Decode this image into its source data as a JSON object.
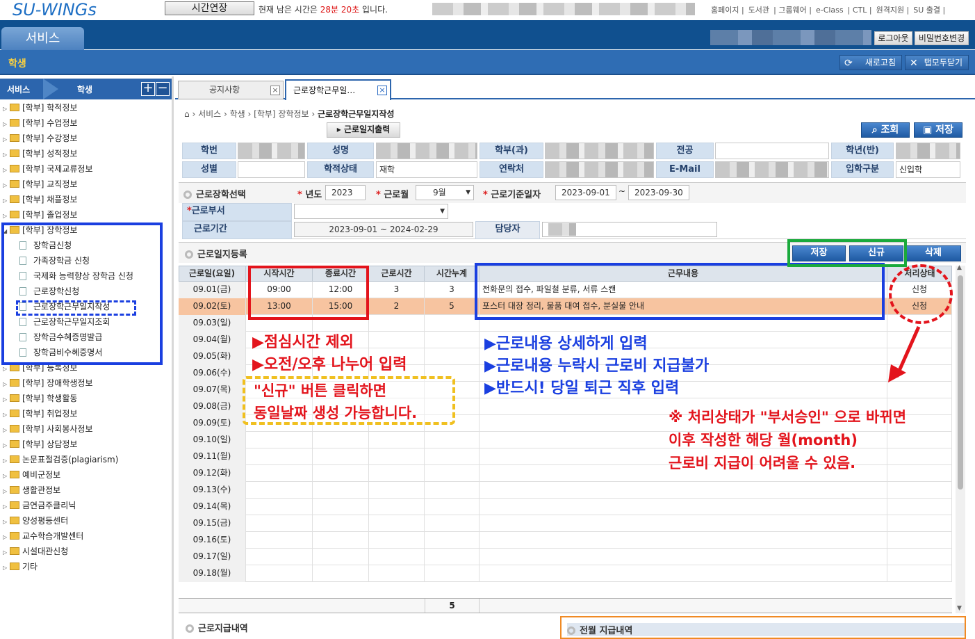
{
  "topbar": {
    "logo": "SU-WINGs",
    "time_extend_button": "시간연장",
    "time_prefix": "현재 남은 시간은 ",
    "time_remaining": "28분 20초",
    "time_suffix": " 입니다.",
    "links": [
      "홈페이지 |",
      "도서관",
      "| 그룹웨어 |",
      "e-Class",
      "| CTL |",
      "원격지원 |",
      "SU 출결 |"
    ]
  },
  "header": {
    "service_tab": "서비스",
    "logout": "로그아웃",
    "password_change": "비밀번호변경"
  },
  "studentbar": {
    "label": "학생",
    "refresh": "새로고침",
    "close_tabs": "탭모두닫기"
  },
  "left": {
    "header_service": "서비스",
    "header_student": "학생",
    "plus": "+",
    "minus": "−",
    "tree_top": [
      "[학부] 학적정보",
      "[학부] 수업정보",
      "[학부] 수강정보",
      "[학부] 성적정보",
      "[학부] 국제교류정보",
      "[학부] 교직정보",
      "[학부] 채플정보",
      "[학부] 졸업정보",
      "[학부] 장학정보"
    ],
    "tree_leaves": [
      "장학금신청",
      "가족장학금 신청",
      "국제화 능력향상 장학금 신청",
      "근로장학신청",
      "근로장학근무일지작성",
      "근로장학근무일지조회",
      "장학금수혜증명발급",
      "장학금비수혜증명서"
    ],
    "tree_bottom": [
      "[학부] 등록정보",
      "[학부] 장애학생정보",
      "[학부] 학생활동",
      "[학부] 취업정보",
      "[학부] 사회봉사정보",
      "[학부] 상담정보",
      "논문표절검증(plagiarism)",
      "예비군정보",
      "생활관정보",
      "금연금주클리닉",
      "양성평등센터",
      "교수학습개발센터",
      "시설대관신청",
      "기타"
    ]
  },
  "tabs": {
    "tab1": "공지사항",
    "tab2": "근로장학근무일…",
    "close": "×"
  },
  "breadcrumb": {
    "items": [
      "서비스",
      "학생",
      "[학부] 장학정보"
    ],
    "current": "근로장학근무일지작성"
  },
  "toolbar": {
    "print": "근로일지출력",
    "search": "조회",
    "save": "저장"
  },
  "student_info": {
    "student_id_label": "학번",
    "name_label": "성명",
    "dept_label": "학부(과)",
    "major_label": "전공",
    "grade_label": "학년(반)",
    "gender_label": "성별",
    "status_label": "학적상태",
    "status_value": "재학",
    "contact_label": "연락처",
    "email_label": "E-Mail",
    "admission_label": "입학구분",
    "admission_value": "신입학"
  },
  "selection": {
    "section_title": "근로장학선택",
    "year_label": "년도",
    "year_value": "2023",
    "month_label": "근로월",
    "month_value": "9월",
    "base_date_label": "근로기준일자",
    "date_from": "2023-09-01",
    "date_sep": "~",
    "date_to": "2023-09-30",
    "dept_label": "근로부서",
    "period_label": "근로기간",
    "period_value": "2023-09-01 ~ 2024-02-29",
    "manager_label": "담당자"
  },
  "log": {
    "section_title": "근로일지등록",
    "save": "저장",
    "new": "신규",
    "delete": "삭제",
    "columns": [
      "근로일(요일)",
      "시작시간",
      "종료시간",
      "근로시간",
      "시간누계",
      "근무내용",
      "처리상태"
    ],
    "rows": [
      {
        "date": "09.01(금)",
        "start": "09:00",
        "end": "12:00",
        "hours": "3",
        "cum": "3",
        "content": "전화문의 접수, 파일철 분류, 서류 스캔",
        "status": "신청"
      },
      {
        "date": "09.02(토)",
        "start": "13:00",
        "end": "15:00",
        "hours": "2",
        "cum": "5",
        "content": "포스터 대장 정리, 물품 대여 접수, 분실물 안내",
        "status": "신청"
      },
      {
        "date": "09.03(일)"
      },
      {
        "date": "09.04(월)"
      },
      {
        "date": "09.05(화)"
      },
      {
        "date": "09.06(수)"
      },
      {
        "date": "09.07(목)"
      },
      {
        "date": "09.08(금)"
      },
      {
        "date": "09.09(토)"
      },
      {
        "date": "09.10(일)"
      },
      {
        "date": "09.11(월)"
      },
      {
        "date": "09.12(화)"
      },
      {
        "date": "09.13(수)"
      },
      {
        "date": "09.14(목)"
      },
      {
        "date": "09.15(금)"
      },
      {
        "date": "09.16(토)"
      },
      {
        "date": "09.17(일)"
      },
      {
        "date": "09.18(월)"
      }
    ],
    "footer_total": "5"
  },
  "annotations": {
    "red1": "▶점심시간 제외",
    "red2": "▶오전/오후 나누어 입력",
    "yellow1": "\"신규\" 버튼 클릭하면",
    "yellow2": "동일날짜 생성 가능합니다.",
    "blue1": "▶근로내용 상세하게 입력",
    "blue2": "▶근로내용 누락시 근로비 지급불가",
    "blue3": "▶반드시! 당일 퇴근 직후 입력",
    "warn1": "※ 처리상태가 \"부서승인\" 으로 바뀌면",
    "warn2": "이후 작성한 해당 월(month)",
    "warn3": "근로비 지급이 어려울 수 있음."
  },
  "bottom": {
    "pay_history": "근로지급내역",
    "prev_month": "전월 지급내역"
  },
  "colors": {
    "header_blue": "#10508f",
    "student_bar": "#2f6db4",
    "highlight_row": "#f7c4a0",
    "annotation_red": "#e3141c",
    "annotation_blue": "#1a3fe0",
    "annotation_green": "#1aaa3c",
    "annotation_yellow": "#f0c020"
  }
}
